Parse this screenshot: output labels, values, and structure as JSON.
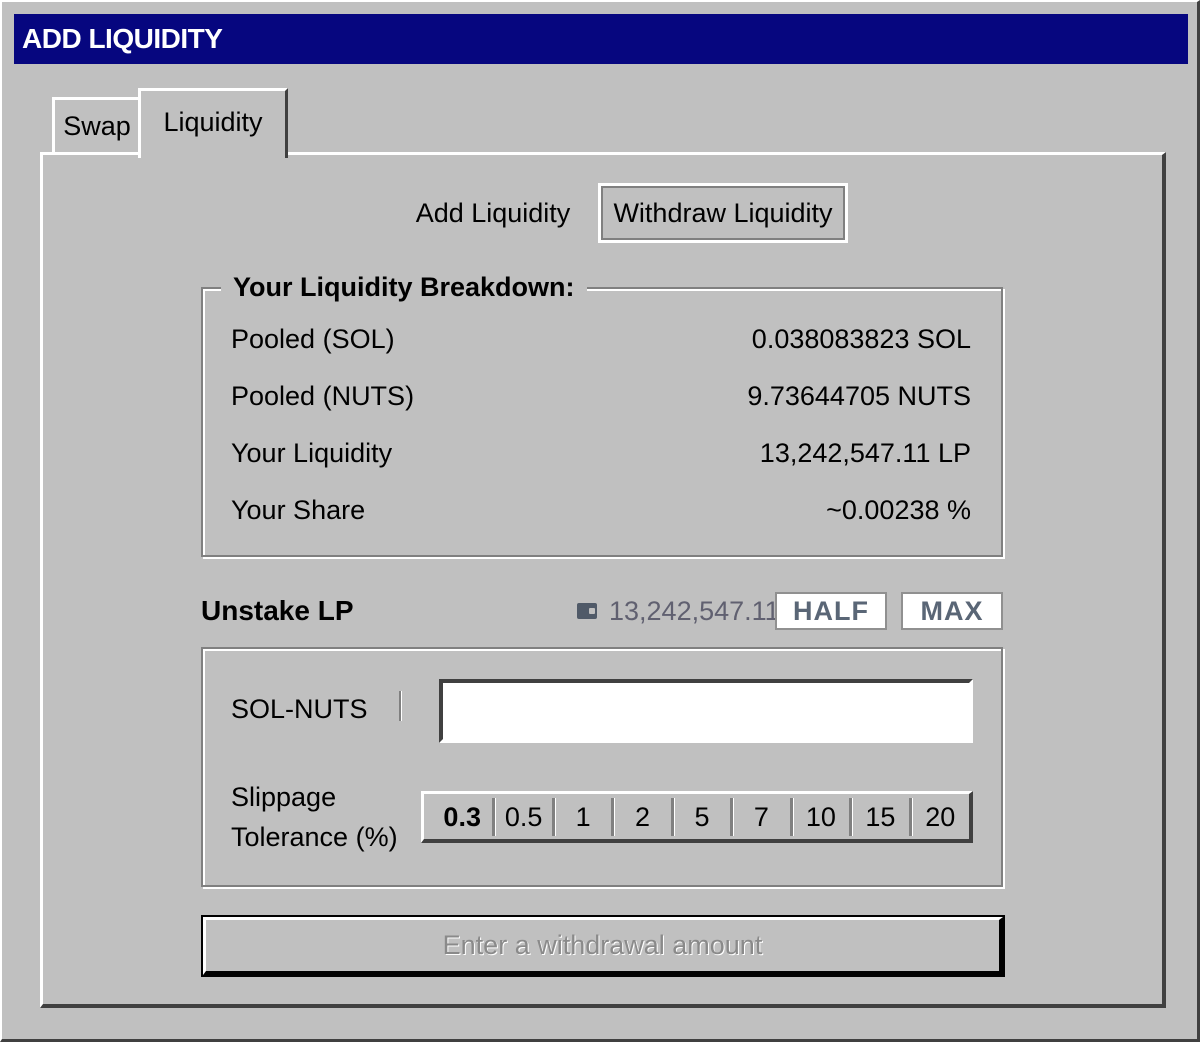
{
  "window": {
    "title": "ADD LIQUIDITY"
  },
  "tabs": [
    {
      "label": "Swap"
    },
    {
      "label": "Liquidity"
    }
  ],
  "mode": {
    "add_label": "Add Liquidity",
    "withdraw_label": "Withdraw Liquidity"
  },
  "breakdown": {
    "title": "Your Liquidity Breakdown:",
    "rows": [
      {
        "label": "Pooled (SOL)",
        "value": "0.038083823 SOL"
      },
      {
        "label": "Pooled (NUTS)",
        "value": "9.73644705 NUTS"
      },
      {
        "label": "Your Liquidity",
        "value": "13,242,547.11 LP"
      },
      {
        "label": "Your Share",
        "value": "~0.00238 %"
      }
    ]
  },
  "unstake": {
    "title": "Unstake LP",
    "wallet_icon": "wallet-icon",
    "balance": "13,242,547.11",
    "half_label": "HALF",
    "max_label": "MAX",
    "pair_label": "SOL-NUTS",
    "amount_value": "",
    "slippage_label_1": "Slippage",
    "slippage_label_2": "Tolerance (%)",
    "slippage_options": [
      "0.3",
      "0.5",
      "1",
      "2",
      "5",
      "7",
      "10",
      "15",
      "20"
    ],
    "slippage_selected": "0.3"
  },
  "submit": {
    "label": "Enter a withdrawal amount"
  }
}
